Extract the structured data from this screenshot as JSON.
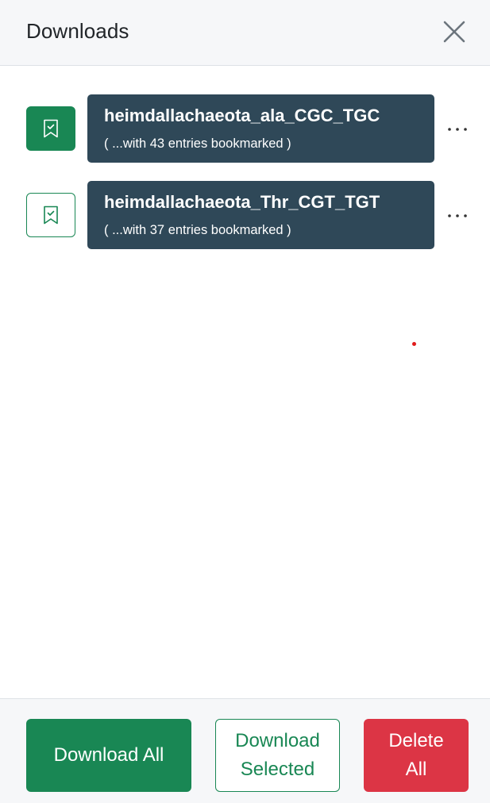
{
  "header": {
    "title": "Downloads",
    "close_icon": "close-icon"
  },
  "downloads": [
    {
      "name": "heimdallachaeota_ala_CGC_TGC",
      "subtitle": "( ...with 43 entries bookmarked )",
      "selected": true,
      "icon": "bookmark-check-icon",
      "more_label": "..."
    },
    {
      "name": "heimdallachaeota_Thr_CGT_TGT",
      "subtitle": "( ...with 37 entries bookmarked )",
      "selected": false,
      "icon": "bookmark-check-icon",
      "more_label": "..."
    }
  ],
  "footer": {
    "download_all_label": "Download All",
    "download_selected_label": "Download Selected",
    "delete_all_label": "Delete All"
  },
  "colors": {
    "success": "#198754",
    "danger": "#dc3545",
    "card_bg": "#2f4858",
    "header_bg": "#f6f7f9"
  }
}
